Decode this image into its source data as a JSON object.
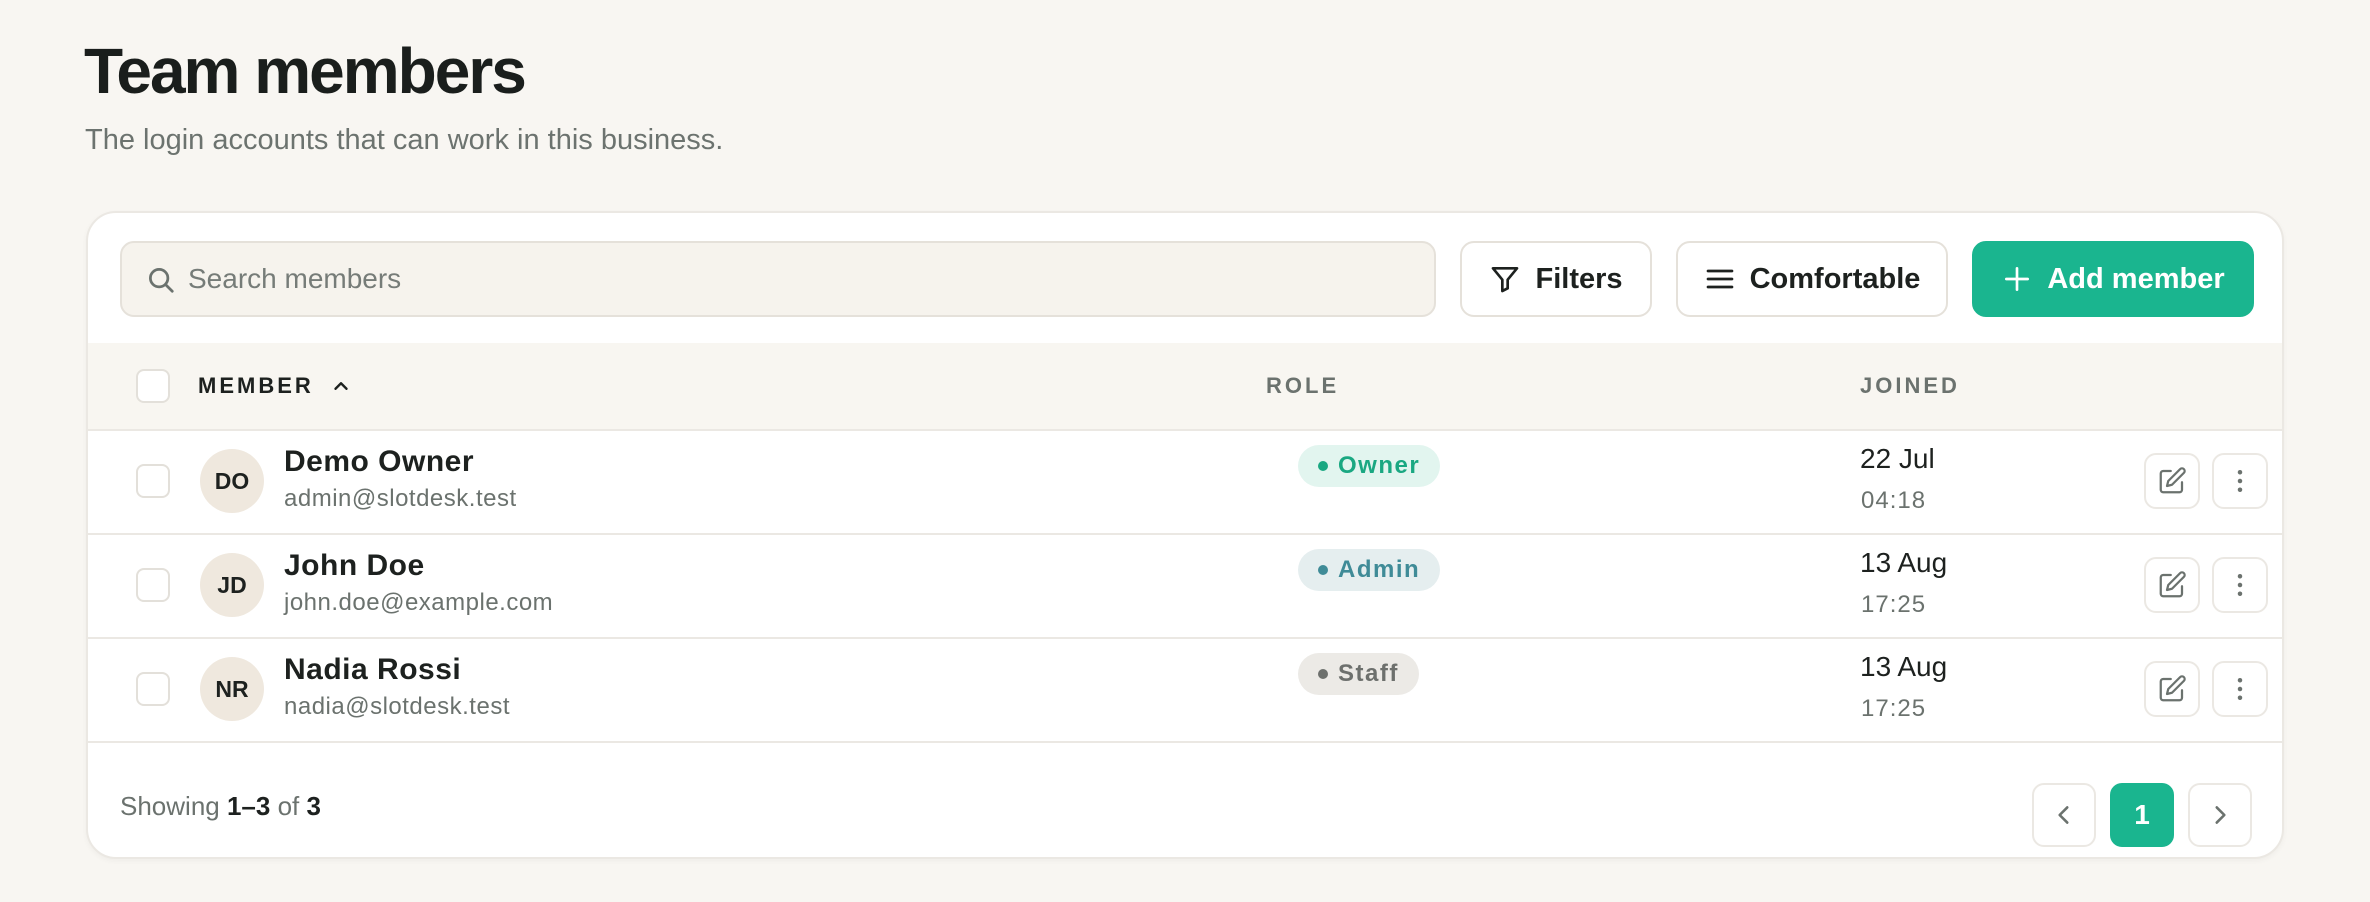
{
  "header": {
    "title": "Team members",
    "subtitle": "The login accounts that can work in this business."
  },
  "toolbar": {
    "search_placeholder": "Search members",
    "search_value": "",
    "filters_label": "Filters",
    "density_label": "Comfortable",
    "add_label": "Add member"
  },
  "table": {
    "columns": {
      "member": "MEMBER",
      "role": "ROLE",
      "joined": "JOINED"
    },
    "sort": {
      "column": "member",
      "direction": "ascending"
    },
    "rows": [
      {
        "initials": "DO",
        "name": "Demo Owner",
        "email": "admin@slotdesk.test",
        "role": "Owner",
        "joined_date": "22 Jul",
        "joined_time": "04:18"
      },
      {
        "initials": "JD",
        "name": "John Doe",
        "email": "john.doe@example.com",
        "role": "Admin",
        "joined_date": "13 Aug",
        "joined_time": "17:25"
      },
      {
        "initials": "NR",
        "name": "Nadia Rossi",
        "email": "nadia@slotdesk.test",
        "role": "Staff",
        "joined_date": "13 Aug",
        "joined_time": "17:25"
      }
    ]
  },
  "footer": {
    "showing_prefix": "Showing",
    "range": "1–3",
    "of_word": "of",
    "total": "3",
    "current_page": "1"
  },
  "colors": {
    "accent": "#1ab58f",
    "background": "#f8f6f2",
    "owner": "#1aa882",
    "admin": "#3f8b97",
    "staff": "#6d706d"
  },
  "icons": {
    "search": "search-icon",
    "filters": "filter-icon",
    "density": "menu-lines-icon",
    "add": "plus-icon",
    "sort": "chevron-up-icon",
    "edit": "edit-icon",
    "more": "more-vertical-icon",
    "prev": "chevron-left-icon",
    "next": "chevron-right-icon"
  }
}
